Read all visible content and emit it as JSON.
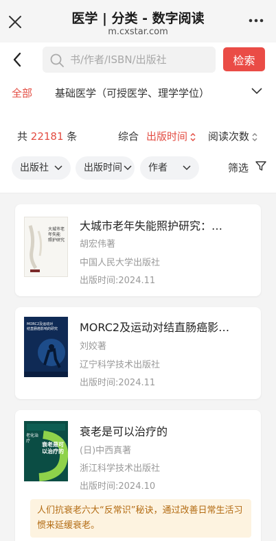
{
  "header": {
    "title": "医学 | 分类 - 数字阅读",
    "url": "m.cxstar.com"
  },
  "search": {
    "placeholder": "书/作者/ISBN/出版社",
    "button_label": "检索"
  },
  "category": {
    "all_label": "全部",
    "selected": "基础医学（可授医学、理学学位）"
  },
  "sort": {
    "count_prefix": "共",
    "count": "22181",
    "count_suffix": "条",
    "options": [
      "综合",
      "出版时间",
      "阅读次数"
    ],
    "active": "出版时间"
  },
  "filters": {
    "chips": [
      "出版社",
      "出版时间",
      "作者"
    ],
    "screen_label": "筛选"
  },
  "books": [
    {
      "title": "大城市老年失能照护研究：…",
      "author": "胡宏伟著",
      "publisher": "中国人民大学出版社",
      "date": "出版时间:2024.11",
      "cover_text": [
        "大城市老年失能",
        "照护研究"
      ]
    },
    {
      "title": "MORC2及运动对结直肠癌影…",
      "author": "刘姣著",
      "publisher": "辽宁科学技术出版社",
      "date": "出版时间:2024.11",
      "cover_text": [
        "MORC2及运动对",
        "结直肠癌影响的研究"
      ]
    },
    {
      "title": "衰老是可以治疗的",
      "author": "(日)中西真著",
      "publisher": "浙江科学技术出版社",
      "date": "出版时间:2024.10",
      "cover_text": [
        "衰老是可以治疗的",
        "老化治疗"
      ],
      "tip": "人们抗衰老六大“反常识”秘诀，通过改善日常生活习惯来延缓衰老。"
    }
  ],
  "colors": {
    "accent": "#e34c42",
    "button": "#ea4c46",
    "tip_bg": "#fdf3e0",
    "tip_text": "#b36b12"
  }
}
